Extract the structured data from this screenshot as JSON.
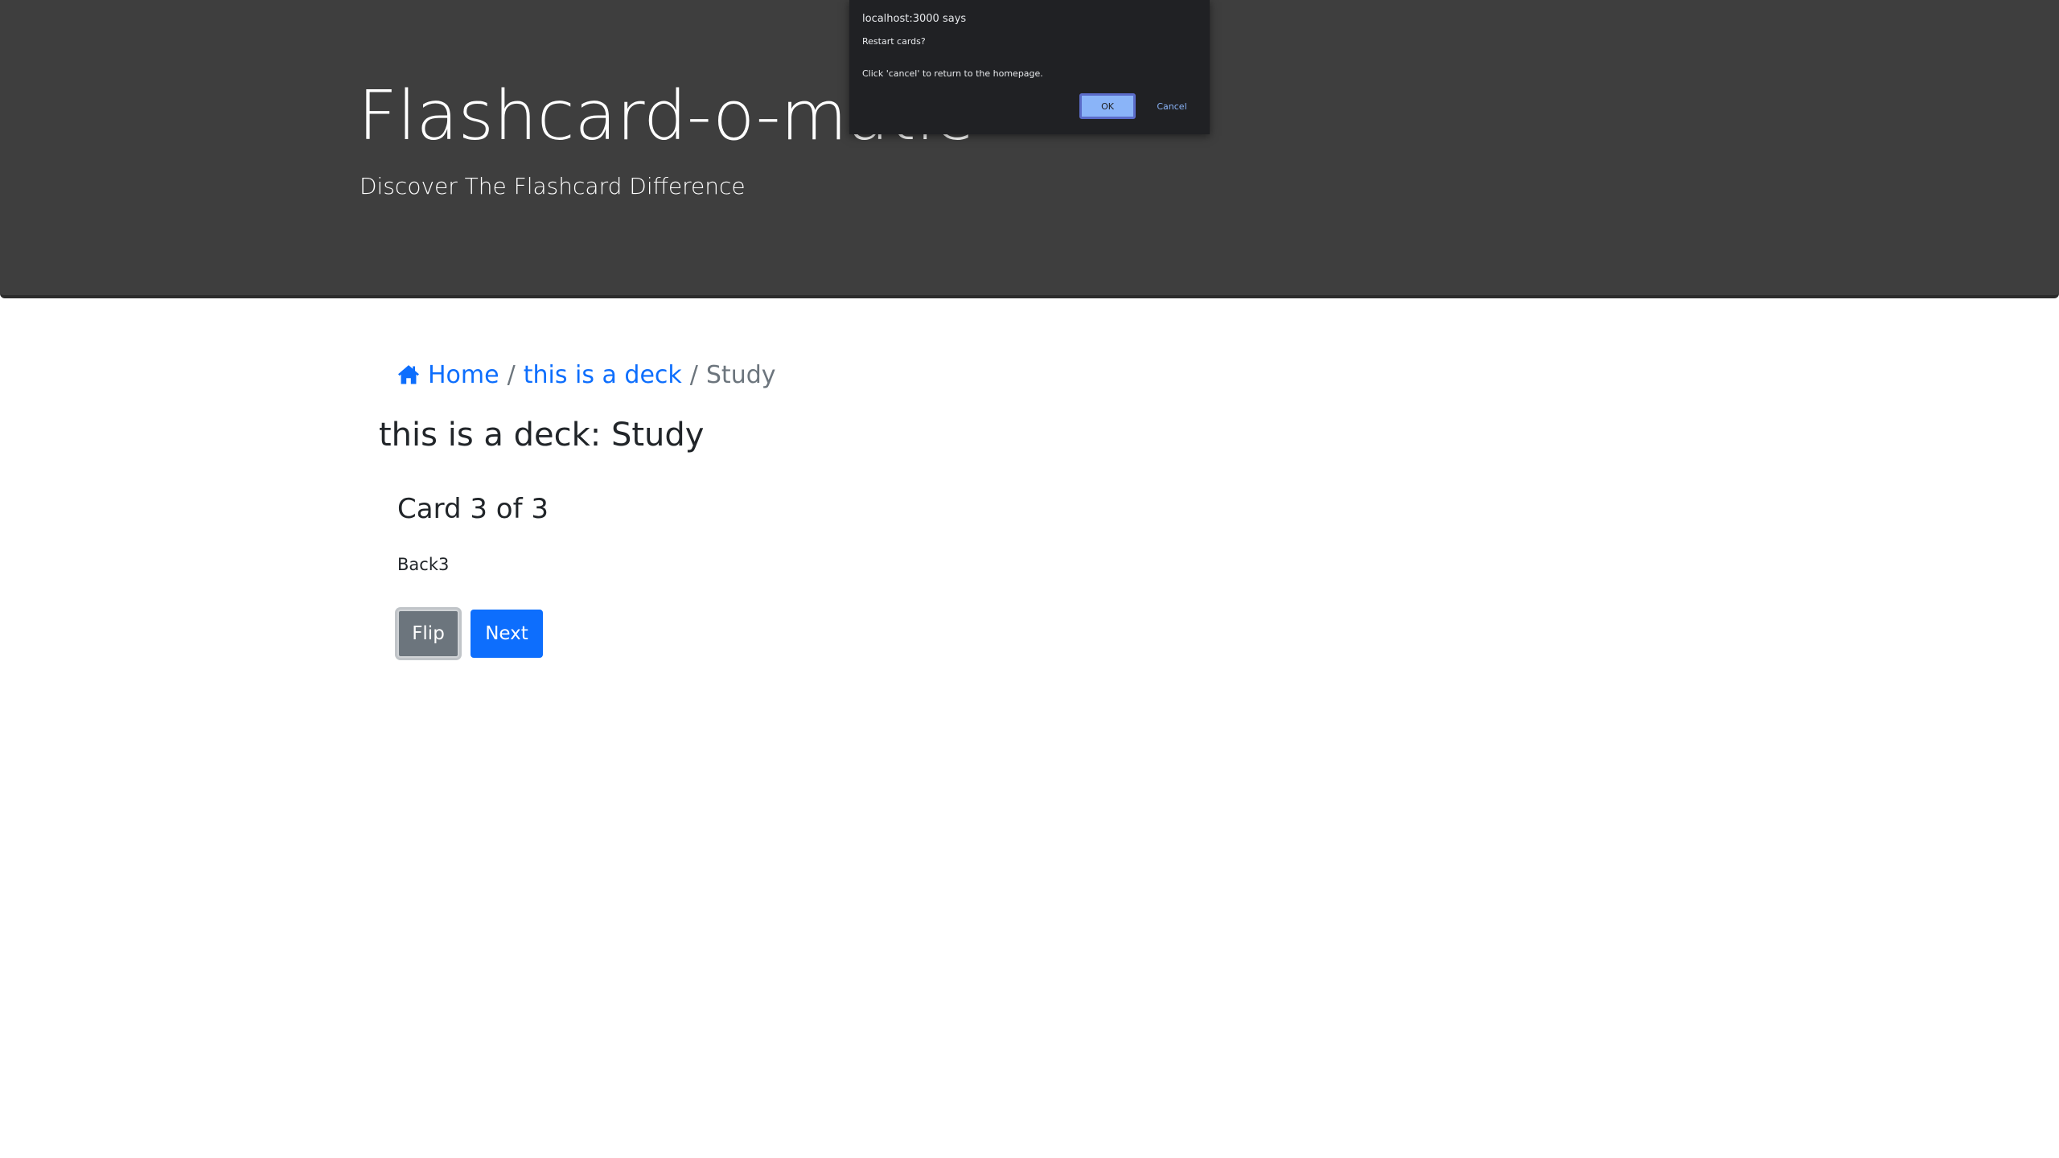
{
  "header": {
    "title": "Flashcard-o-matic",
    "tagline": "Discover The Flashcard Difference"
  },
  "dialog": {
    "origin": "localhost:3000 says",
    "line1": "Restart cards?",
    "line2": "Click 'cancel' to return to the homepage.",
    "ok_label": "OK",
    "cancel_label": "Cancel"
  },
  "breadcrumb": {
    "icon": "house-icon",
    "home_label": "Home",
    "deck_label": "this is a deck",
    "separator": "/",
    "current_label": "Study"
  },
  "page": {
    "heading": "this is a deck: Study"
  },
  "card": {
    "title": "Card 3 of 3",
    "text": "Back3",
    "flip_label": "Flip",
    "next_label": "Next"
  },
  "colors": {
    "header_bg": "#3e3e3e",
    "link": "#0d6efd",
    "secondary_button": "#6c757d",
    "primary_button": "#0d6efd"
  }
}
